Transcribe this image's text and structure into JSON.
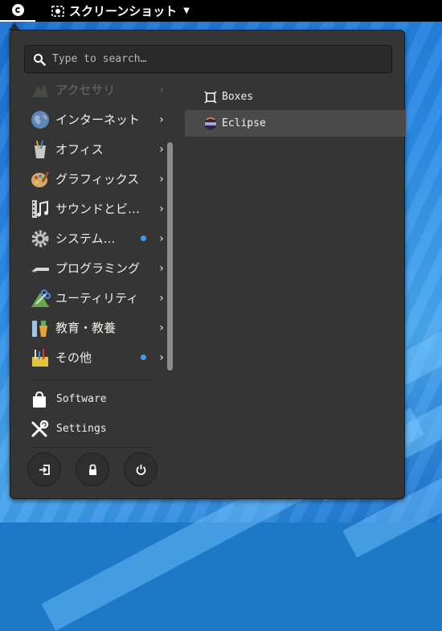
{
  "topbar": {
    "app_menu_label": "スクリーンショット",
    "icons": [
      "activities-logo-icon",
      "screenshot-camera-icon",
      "caret-down-icon"
    ]
  },
  "menu": {
    "search": {
      "placeholder": "Type to search…",
      "value": ""
    },
    "categories": [
      {
        "label": "アクセサリ",
        "icon": "accessories-icon",
        "faded": true,
        "dot": false
      },
      {
        "label": "インターネット",
        "icon": "internet-globe-icon",
        "faded": false,
        "dot": false
      },
      {
        "label": "オフィス",
        "icon": "office-icon",
        "faded": false,
        "dot": false
      },
      {
        "label": "グラフィックス",
        "icon": "graphics-palette-icon",
        "faded": false,
        "dot": false
      },
      {
        "label": "サウンドとビ…",
        "icon": "sound-video-icon",
        "faded": false,
        "dot": false
      },
      {
        "label": "システム…",
        "icon": "system-gear-icon",
        "faded": false,
        "dot": true
      },
      {
        "label": "プログラミング",
        "icon": "programming-icon",
        "faded": false,
        "dot": false
      },
      {
        "label": "ユーティリティ",
        "icon": "utilities-icon",
        "faded": false,
        "dot": false
      },
      {
        "label": "教育・教養",
        "icon": "education-icon",
        "faded": false,
        "dot": false
      },
      {
        "label": "その他",
        "icon": "other-icon",
        "faded": false,
        "dot": true
      }
    ],
    "system_items": [
      {
        "label": "Software",
        "icon": "software-bag-icon"
      },
      {
        "label": "Settings",
        "icon": "settings-tools-icon"
      }
    ],
    "actions": [
      "logout-icon",
      "lock-icon",
      "power-icon"
    ],
    "apps": [
      {
        "label": "Boxes",
        "icon": "boxes-icon",
        "selected": false
      },
      {
        "label": "Eclipse",
        "icon": "eclipse-icon",
        "selected": true
      }
    ],
    "colors": {
      "panel": "#353535",
      "selected": "#4a4a4a",
      "dot": "#3d9bf5"
    }
  }
}
